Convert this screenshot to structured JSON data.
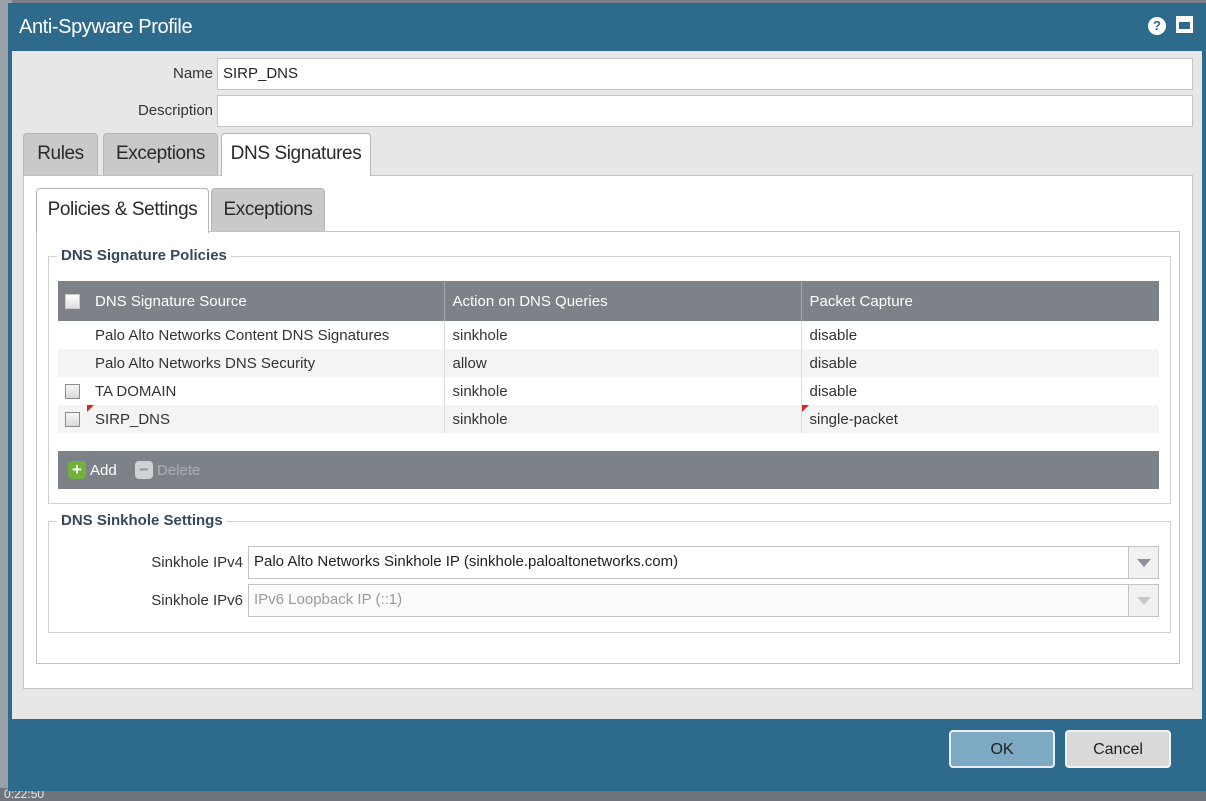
{
  "dialog": {
    "title": "Anti-Spyware Profile"
  },
  "form": {
    "name_label": "Name",
    "name_value": "SIRP_DNS",
    "description_label": "Description",
    "description_value": ""
  },
  "tabs": [
    {
      "label": "Rules",
      "active": false
    },
    {
      "label": "Exceptions",
      "active": false
    },
    {
      "label": "DNS Signatures",
      "active": true
    }
  ],
  "subtabs": [
    {
      "label": "Policies & Settings",
      "active": true
    },
    {
      "label": "Exceptions",
      "active": false
    }
  ],
  "dns_policies": {
    "legend": "DNS Signature Policies",
    "columns": [
      "DNS Signature Source",
      "Action on DNS Queries",
      "Packet Capture"
    ],
    "rows": [
      {
        "source": "Palo Alto Networks Content DNS Signatures",
        "action": "sinkhole",
        "capture": "disable",
        "checkbox": false
      },
      {
        "source": "Palo Alto Networks DNS Security",
        "action": "allow",
        "capture": "disable",
        "checkbox": false
      },
      {
        "source": "TA DOMAIN",
        "action": "sinkhole",
        "capture": "disable",
        "checkbox": true
      },
      {
        "source": "SIRP_DNS",
        "action": "sinkhole",
        "capture": "single-packet",
        "checkbox": true
      }
    ],
    "add_label": "Add",
    "delete_label": "Delete"
  },
  "sinkhole": {
    "legend": "DNS Sinkhole Settings",
    "ipv4_label": "Sinkhole IPv4",
    "ipv4_value": "Palo Alto Networks Sinkhole IP (sinkhole.paloaltonetworks.com)",
    "ipv6_label": "Sinkhole IPv6",
    "ipv6_value": "IPv6 Loopback IP (::1)"
  },
  "buttons": {
    "ok": "OK",
    "cancel": "Cancel"
  },
  "background": {
    "clock_fragment": "0:22:50"
  },
  "colors": {
    "titlebar": "#2e6a8c",
    "grid_header": "#7d8288",
    "add_icon": "#72b23b",
    "modified_flag": "#d7261e"
  }
}
